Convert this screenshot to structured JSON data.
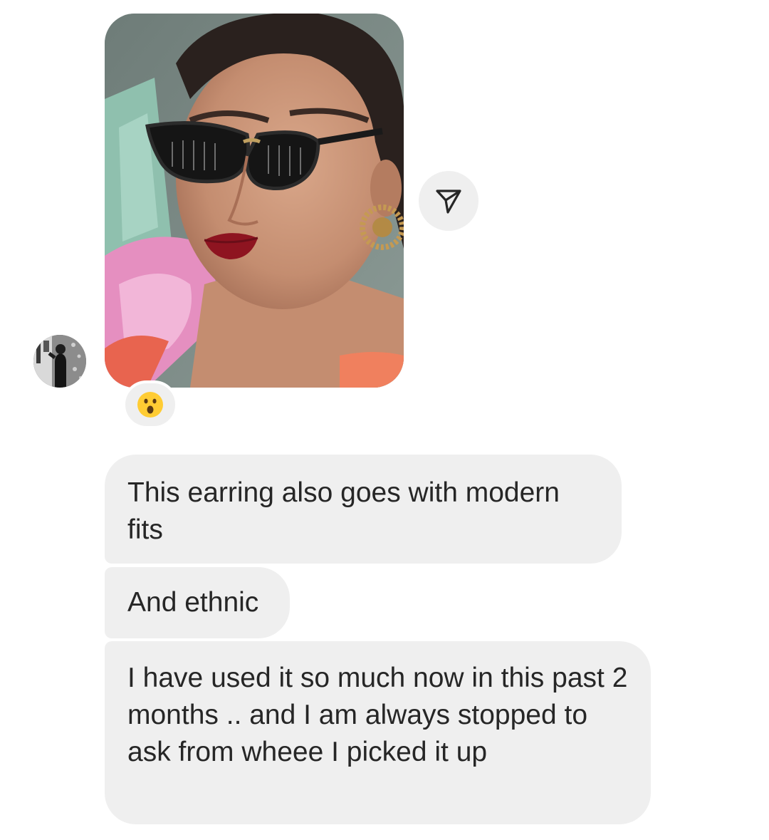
{
  "conversation": {
    "sender_avatar": {
      "icon": "avatar-photo"
    },
    "photo_message": {
      "icon": "selfie-photo"
    },
    "share_button": {
      "icon": "paper-plane-icon"
    },
    "reaction": {
      "emoji": "😮",
      "icon": "surprised-face-emoji"
    },
    "messages": [
      {
        "text": "This earring also goes with modern fits"
      },
      {
        "text": "And ethnic"
      },
      {
        "text": "I have used it so much now in this past 2 months .. and I am always stopped to ask from wheee I picked it up"
      }
    ]
  },
  "colors": {
    "bubble_bg": "#efefef",
    "text": "#262626",
    "page_bg": "#ffffff"
  }
}
